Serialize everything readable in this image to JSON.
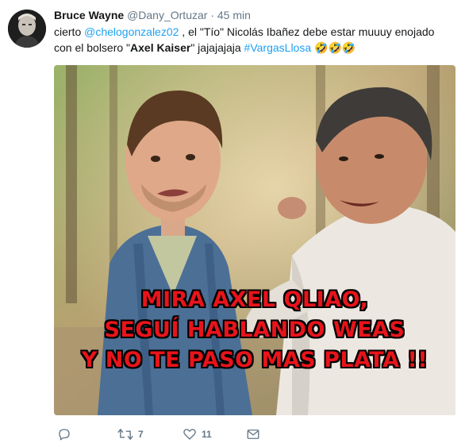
{
  "tweet": {
    "author_name": "Bruce Wayne",
    "author_handle": "@Dany_Ortuzar",
    "separator": "·",
    "time": "45 min",
    "text_parts": {
      "p1": "cierto ",
      "mention": "@chelogonzalez02",
      "p2": " ,   el \"Tío\" Nicolás Ibañez debe estar muuuy enojado con el bolsero \"",
      "bold": "Axel Kaiser",
      "p3": "\" jajajajaja ",
      "hashtag": "#VargasLlosa",
      "emoji": " 🤣🤣🤣"
    },
    "image_caption": {
      "line1": "MIRA AXEL QLIAO,",
      "line2": "SEGUÍ HABLANDO WEAS",
      "line3": "Y  NO TE PASO MAS PLATA !!"
    },
    "actions": {
      "reply_count": "",
      "retweet_count": "7",
      "like_count": "11"
    }
  },
  "colors": {
    "link": "#1da1f2",
    "meta": "#657786",
    "caption_red": "#e8141b"
  },
  "icons": [
    "avatar",
    "reply-icon",
    "retweet-icon",
    "like-icon",
    "message-icon"
  ]
}
